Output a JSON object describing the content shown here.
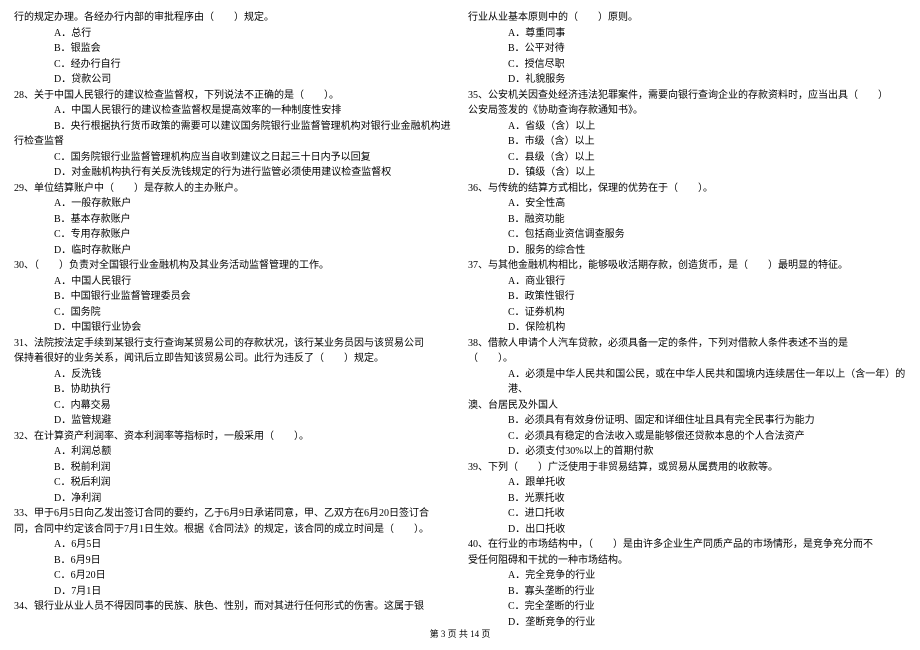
{
  "left": {
    "pre27": [
      "行的规定办理。各经办行内部的审批程序由（　　）规定。",
      "A．总行",
      "B．银监会",
      "C．经办行自行",
      "D．贷款公司"
    ],
    "q28": {
      "stem": "28、关于中国人民银行的建议检查监督权，下列说法不正确的是（　　）。",
      "opts": [
        "A．中国人民银行的建议检查监督权是提高效率的一种制度性安排",
        "B．央行根据执行货币政策的需要可以建议国务院银行业监督管理机构对银行业金融机构进"
      ],
      "cont": "行检查监督",
      "opts2": [
        "C．国务院银行业监督管理机构应当自收到建议之日起三十日内予以回复",
        "D．对金融机构执行有关反洗钱规定的行为进行监管必须使用建议检查监督权"
      ]
    },
    "q29": {
      "stem": "29、单位结算账户中（　　）是存款人的主办账户。",
      "opts": [
        "A．一般存款账户",
        "B．基本存款账户",
        "C．专用存款账户",
        "D．临时存款账户"
      ]
    },
    "q30": {
      "stem": "30、（　　）负责对全国银行业金融机构及其业务活动监督管理的工作。",
      "opts": [
        "A．中国人民银行",
        "B．中国银行业监督管理委员会",
        "C．国务院",
        "D．中国银行业协会"
      ]
    },
    "q31": {
      "stem1": "31、法院按法定手续到某银行支行查询某贸易公司的存款状况，该行某业务员因与该贸易公司",
      "stem2": "保持着很好的业务关系，闻讯后立即告知该贸易公司。此行为违反了（　　）规定。",
      "opts": [
        "A．反洗钱",
        "B．协助执行",
        "C．内幕交易",
        "D．监管规避"
      ]
    },
    "q32": {
      "stem": "32、在计算资产利润率、资本利润率等指标时，一般采用（　　）。",
      "opts": [
        "A．利润总额",
        "B．税前利润",
        "C．税后利润",
        "D．净利润"
      ]
    },
    "q33": {
      "stem1": "33、甲于6月5日向乙发出签订合同的要约，乙于6月9日承诺同意，甲、乙双方在6月20日签订合",
      "stem2": "同，合同中约定该合同于7月1日生效。根据《合同法》的规定，该合同的成立时间是（　　）。",
      "opts": [
        "A．6月5日",
        "B．6月9日",
        "C．6月20日",
        "D．7月1日"
      ]
    },
    "q34": {
      "stem": "34、银行业从业人员不得因同事的民族、肤色、性别，而对其进行任何形式的伤害。这属于银"
    }
  },
  "right": {
    "pre34": {
      "cont": "行业从业基本原则中的（　　）原则。",
      "opts": [
        "A．尊重同事",
        "B．公平对待",
        "C．授信尽职",
        "D．礼貌服务"
      ]
    },
    "q35": {
      "stem1": "35、公安机关因查处经济违法犯罪案件，需要向银行查询企业的存款资料时，应当出具（　　）",
      "stem2": "公安局签发的《协助查询存款通知书》。",
      "opts": [
        "A．省级（含）以上",
        "B．市级（含）以上",
        "C．县级（含）以上",
        "D．镇级（含）以上"
      ]
    },
    "q36": {
      "stem": "36、与传统的结算方式相比，保理的优势在于（　　）。",
      "opts": [
        "A．安全性高",
        "B．融资功能",
        "C．包括商业资信调查服务",
        "D．服务的综合性"
      ]
    },
    "q37": {
      "stem": "37、与其他金融机构相比，能够吸收活期存款，创造货币，是（　　）最明显的特征。",
      "opts": [
        "A．商业银行",
        "B．政策性银行",
        "C．证券机构",
        "D．保险机构"
      ]
    },
    "q38": {
      "stem1": "38、借款人申请个人汽车贷款，必须具备一定的条件，下列对借款人条件表述不当的是",
      "stem2": "（　　）。",
      "optA1": "A．必须是中华人民共和国公民，或在中华人民共和国境内连续居住一年以上（含一年）的港、",
      "optA2": "澳、台居民及外国人",
      "opts": [
        "B．必须具有有效身份证明、固定和详细住址且具有完全民事行为能力",
        "C．必须具有稳定的合法收入或是能够偿还贷款本息的个人合法资产",
        "D．必须支付30%以上的首期付款"
      ]
    },
    "q39": {
      "stem": "39、下列（　　）广泛使用于非贸易结算，或贸易从属费用的收款等。",
      "opts": [
        "A．跟单托收",
        "B．光票托收",
        "C．进口托收",
        "D．出口托收"
      ]
    },
    "q40": {
      "stem1": "40、在行业的市场结构中，（　　）是由许多企业生产同质产品的市场情形，是竞争充分而不",
      "stem2": "受任何阻碍和干扰的一种市场结构。",
      "opts": [
        "A．完全竞争的行业",
        "B．寡头垄断的行业",
        "C．完全垄断的行业",
        "D．垄断竞争的行业"
      ]
    }
  },
  "footer": "第 3 页 共 14 页"
}
